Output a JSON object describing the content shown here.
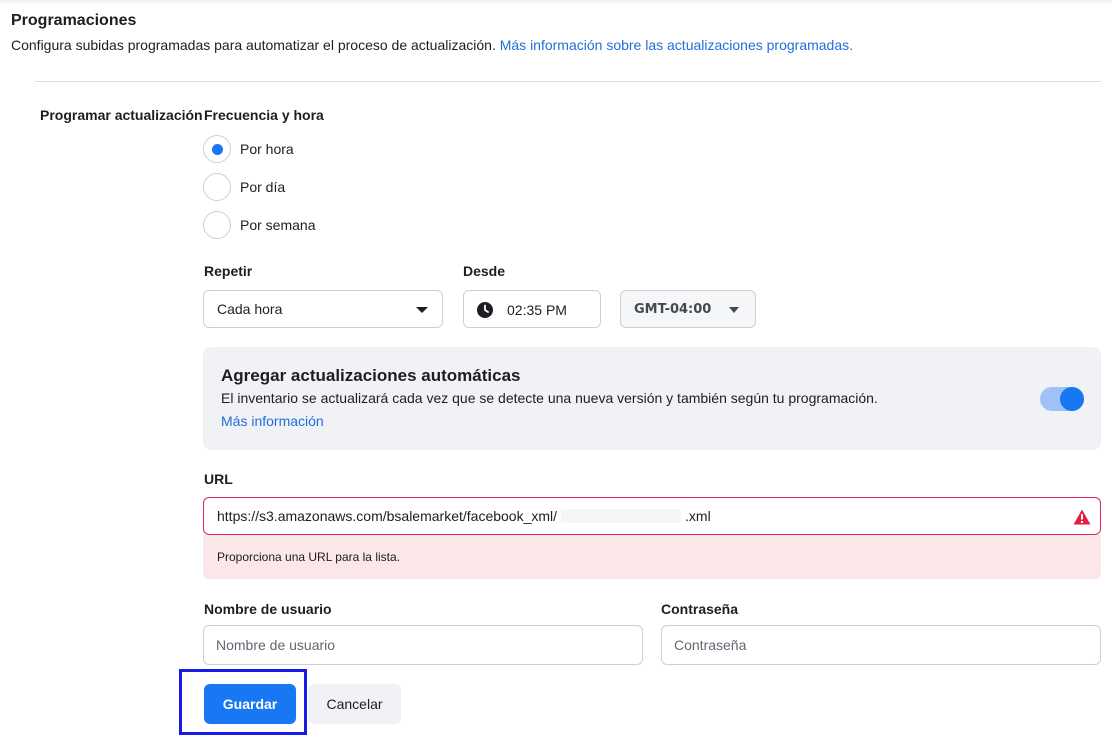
{
  "header": {
    "title": "Programaciones",
    "description": "Configura subidas programadas para automatizar el proceso de actualización.",
    "link": "Más información sobre las actualizaciones programadas."
  },
  "schedule": {
    "side_label": "Programar actualización",
    "frequency_label": "Frecuencia y hora",
    "options": [
      {
        "label": "Por hora",
        "selected": true
      },
      {
        "label": "Por día",
        "selected": false
      },
      {
        "label": "Por semana",
        "selected": false
      }
    ],
    "repeat_label": "Repetir",
    "repeat_value": "Cada hora",
    "from_label": "Desde",
    "time_hour": "02",
    "time_min": "35",
    "time_ampm": "PM",
    "timezone": "GMT-04:00"
  },
  "auto_updates": {
    "title": "Agregar actualizaciones automáticas",
    "description": "El inventario se actualizará cada vez que se detecte una nueva versión y también según tu programación.",
    "link": "Más información",
    "enabled": true
  },
  "url": {
    "label": "URL",
    "value_prefix": "https://s3.amazonaws.com/bsalemarket/facebook_xml/",
    "value_suffix": ".xml",
    "error": "Proporciona una URL para la lista."
  },
  "credentials": {
    "username_label": "Nombre de usuario",
    "username_placeholder": "Nombre de usuario",
    "password_label": "Contraseña",
    "password_placeholder": "Contraseña"
  },
  "actions": {
    "save": "Guardar",
    "cancel": "Cancelar"
  },
  "colors": {
    "accent": "#1877f2",
    "link": "#216fdb",
    "error_border": "#e0245e",
    "error_bg": "#fbe6e8",
    "focus_ring": "#1a1ae6"
  }
}
